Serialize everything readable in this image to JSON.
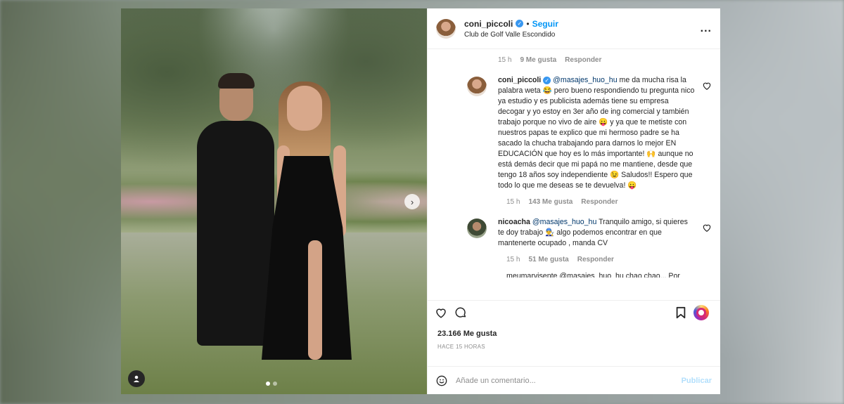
{
  "post": {
    "username": "coni_piccoli",
    "separator": "•",
    "follow_label": "Seguir",
    "location": "Club de Golf Valle Escondido",
    "more_label": "..."
  },
  "comments": {
    "top_meta": {
      "time": "15 h",
      "likes": "9 Me gusta",
      "reply": "Responder"
    },
    "items": [
      {
        "username": "coni_piccoli",
        "mention": "@masajes_huo_hu",
        "text": " me da mucha risa la palabra weta 😂 pero bueno respondiendo tu pregunta nico ya estudio y es publicista además tiene su empresa decogar y yo estoy en 3er año de ing comercial y también trabajo porque no vivo de aire 😛 y ya que te metiste con nuestros papas te explico que mi hermoso padre se ha sacado la chucha trabajando para darnos lo mejor EN EDUCACIÓN que hoy es lo más importante! 🙌 aunque no está demás decir que mi papá no me mantiene, desde que tengo 18 años soy independiente 😉 Saludos!! Espero que todo lo que me deseas se te devuelva! 😛",
        "time": "15 h",
        "likes": "143 Me gusta",
        "reply": "Responder"
      },
      {
        "username": "nicoacha",
        "mention": "@masajes_huo_hu",
        "text": " Tranquilo amigo, si quieres te doy trabajo 👨‍🔧 algo podemos encontrar en que mantenerte ocupado , manda CV",
        "time": "15 h",
        "likes": "51 Me gusta",
        "reply": "Responder"
      }
    ],
    "partial_text": "meumarvisente @masajes_huo_hu chao chao... Por"
  },
  "likes_count": "23.166 Me gusta",
  "time_ago": "HACE 15 HORAS",
  "add_comment": {
    "placeholder": "Añade un comentario...",
    "publish_label": "Publicar"
  },
  "icons": {
    "heart": "heart-icon",
    "comment": "comment-icon",
    "save": "bookmark-icon",
    "emoji": "emoji-icon",
    "next": "chevron-right-icon",
    "tag": "user-tag-icon"
  },
  "colors": {
    "follow_blue": "#0095f6",
    "mention_blue": "#00376b",
    "muted": "#8e8e8e"
  }
}
